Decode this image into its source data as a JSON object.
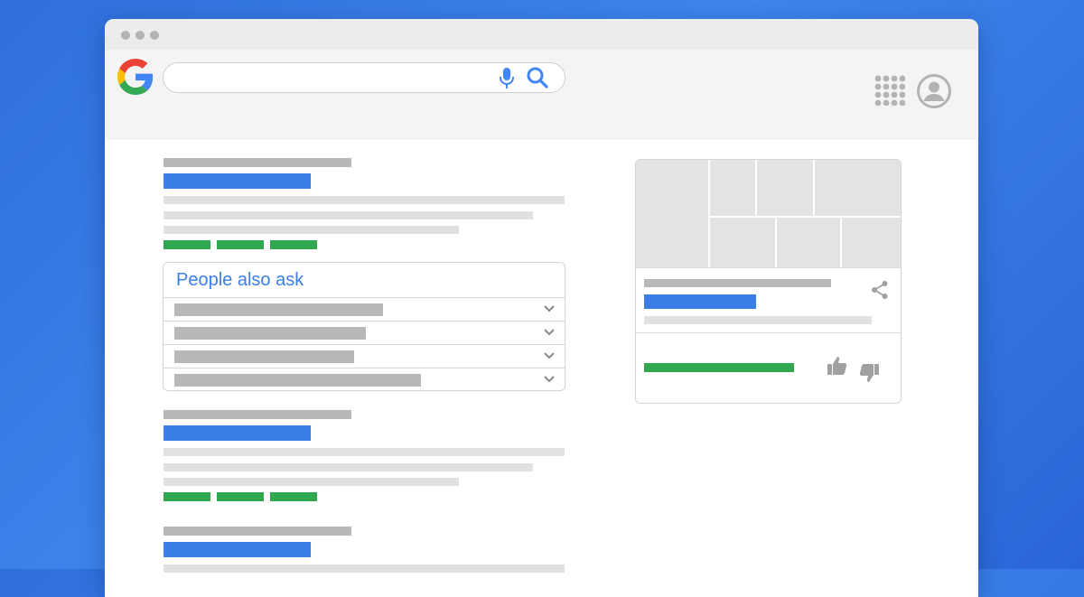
{
  "people_also_ask": {
    "title": "People also ask",
    "question_count": 4
  },
  "icons": {
    "logo": "google-g-logo",
    "mic": "microphone-icon",
    "search": "magnifier-icon",
    "apps": "apps-grid-icon",
    "account": "account-avatar-icon",
    "share": "share-icon",
    "thumb_up": "thumbs-up-icon",
    "thumb_down": "thumbs-down-icon",
    "expand": "chevron-down-icon"
  },
  "colors": {
    "background": "#3077e0",
    "link_blue": "#3b7ee6",
    "url_green": "#2fa84f",
    "placeholder_gray": "#b8b8b8",
    "light_gray": "#e1e1e1",
    "google_blue": "#4285F4",
    "google_red": "#EA4335",
    "google_yellow": "#FBBC05",
    "google_green": "#34A853"
  }
}
